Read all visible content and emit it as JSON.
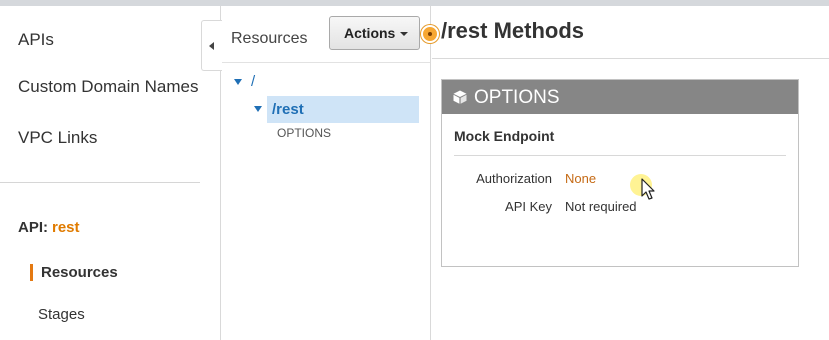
{
  "nav": {
    "apis": "APIs",
    "custom_domains": "Custom Domain Names",
    "vpc_links": "VPC Links",
    "api_prefix": "API:",
    "api_name": "rest",
    "resources": "Resources",
    "stages": "Stages"
  },
  "resources_panel": {
    "title": "Resources",
    "actions_label": "Actions",
    "tree": {
      "root": "/",
      "child": "/rest",
      "method": "OPTIONS"
    }
  },
  "methods_panel": {
    "title": "/rest Methods",
    "card": {
      "method": "OPTIONS",
      "integration": "Mock Endpoint",
      "rows": [
        {
          "label": "Authorization",
          "value": "None"
        },
        {
          "label": "API Key",
          "value": "Not required"
        }
      ]
    }
  },
  "colors": {
    "accent": "#e47911",
    "link": "#1f6fb5",
    "selection": "#cfe4f7",
    "card_header": "#868686"
  },
  "icons": [
    "collapse-arrow-icon",
    "caret-down-icon",
    "tree-expand-icon",
    "cube-icon",
    "mouse-cursor-icon"
  ]
}
